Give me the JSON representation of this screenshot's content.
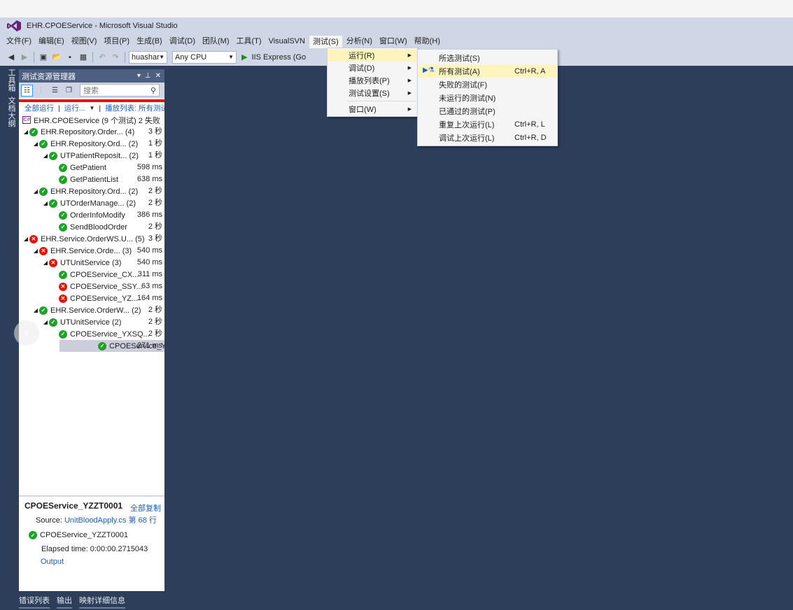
{
  "window": {
    "title": "EHR.CPOEService - Microsoft Visual Studio"
  },
  "menubar": [
    "文件(F)",
    "编辑(E)",
    "视图(V)",
    "项目(P)",
    "生成(B)",
    "调试(D)",
    "团队(M)",
    "工具(T)",
    "VisualSVN",
    "测试(S)",
    "分析(N)",
    "窗口(W)",
    "帮助(H)"
  ],
  "toolbar": {
    "config": "huashar",
    "platform": "Any CPU",
    "run_target": "IIS Express (Go"
  },
  "side_tabs": [
    "工具箱",
    "文档大纲"
  ],
  "test_explorer": {
    "title": "测试资源管理器",
    "search_placeholder": "搜索",
    "run_all": "全部运行",
    "run": "运行...",
    "playlist": "播放列表: 所有测试",
    "root": "EHR.CPOEService (9 个测试) 2 失败",
    "rows": [
      {
        "level": 0,
        "expand": true,
        "status": "ok",
        "name": "EHR.Repository.Order... (4)",
        "time": "3 秒"
      },
      {
        "level": 1,
        "expand": true,
        "status": "ok",
        "name": "EHR.Repository.Ord... (2)",
        "time": "1 秒"
      },
      {
        "level": 2,
        "expand": true,
        "status": "ok",
        "name": "UTPatientReposit... (2)",
        "time": "1 秒"
      },
      {
        "level": 3,
        "expand": false,
        "status": "ok",
        "name": "GetPatient",
        "time": "598 ms"
      },
      {
        "level": 3,
        "expand": false,
        "status": "ok",
        "name": "GetPatientList",
        "time": "638 ms"
      },
      {
        "level": 1,
        "expand": true,
        "status": "ok",
        "name": "EHR.Repository.Ord... (2)",
        "time": "2 秒"
      },
      {
        "level": 2,
        "expand": true,
        "status": "ok",
        "name": "UTOrderManage... (2)",
        "time": "2 秒"
      },
      {
        "level": 3,
        "expand": false,
        "status": "ok",
        "name": "OrderInfoModify",
        "time": "386 ms"
      },
      {
        "level": 3,
        "expand": false,
        "status": "ok",
        "name": "SendBloodOrder",
        "time": "2 秒"
      },
      {
        "level": 0,
        "expand": true,
        "status": "fail",
        "name": "EHR.Service.OrderWS.U... (5)",
        "time": "3 秒"
      },
      {
        "level": 1,
        "expand": true,
        "status": "fail",
        "name": "EHR.Service.Orde... (3)",
        "time": "540 ms"
      },
      {
        "level": 2,
        "expand": true,
        "status": "fail",
        "name": "UTUnitService (3)",
        "time": "540 ms"
      },
      {
        "level": 3,
        "expand": false,
        "status": "ok",
        "name": "CPOEService_CX...",
        "time": "311 ms"
      },
      {
        "level": 3,
        "expand": false,
        "status": "fail",
        "name": "CPOEService_SSY...",
        "time": "63 ms"
      },
      {
        "level": 3,
        "expand": false,
        "status": "fail",
        "name": "CPOEService_YZ...",
        "time": "164 ms"
      },
      {
        "level": 1,
        "expand": true,
        "status": "ok",
        "name": "EHR.Service.OrderW... (2)",
        "time": "2 秒"
      },
      {
        "level": 2,
        "expand": true,
        "status": "ok",
        "name": "UTUnitService (2)",
        "time": "2 秒"
      },
      {
        "level": 3,
        "expand": false,
        "status": "ok",
        "name": "CPOEService_YXSQ...",
        "time": "2 秒"
      },
      {
        "level": 3,
        "expand": false,
        "status": "ok",
        "name": "CPOEService_YZ...",
        "time": "271 ms",
        "selected": true
      }
    ]
  },
  "detail": {
    "name": "CPOEService_YZZT0001",
    "copy_all": "全部复制",
    "source_label": "Source:",
    "source_link": "UnitBloodApply.cs 第 68 行",
    "result": "CPOEService_YZZT0001",
    "elapsed": "Elapsed time: 0:00:00.2715043",
    "output": "Output"
  },
  "bottom_tabs": [
    "错误列表",
    "输出",
    "映射详细信息"
  ],
  "test_menu": [
    {
      "label": "运行(R)",
      "sub": true,
      "hover": true
    },
    {
      "label": "调试(D)",
      "sub": true
    },
    {
      "label": "播放列表(P)",
      "sub": true
    },
    {
      "label": "测试设置(S)",
      "sub": true
    },
    {
      "label": "窗口(W)",
      "sub": true,
      "sep_before": true
    }
  ],
  "run_submenu": [
    {
      "label": "所选测试(S)",
      "shortcut": ""
    },
    {
      "label": "所有测试(A)",
      "shortcut": "Ctrl+R, A",
      "hover": true,
      "icon": true
    },
    {
      "label": "失败的测试(F)",
      "shortcut": ""
    },
    {
      "label": "未运行的测试(N)",
      "shortcut": ""
    },
    {
      "label": "已通过的测试(P)",
      "shortcut": ""
    },
    {
      "label": "重复上次运行(L)",
      "shortcut": "Ctrl+R, L"
    },
    {
      "label": "调试上次运行(L)",
      "shortcut": "Ctrl+R, D"
    }
  ],
  "colors": {
    "bg": "#2d3e5a",
    "chrome": "#cfd6e5",
    "pass": "#1fa12a",
    "fail": "#e51400",
    "link": "#1e5fb8",
    "highlight": "#fdf4bf"
  }
}
